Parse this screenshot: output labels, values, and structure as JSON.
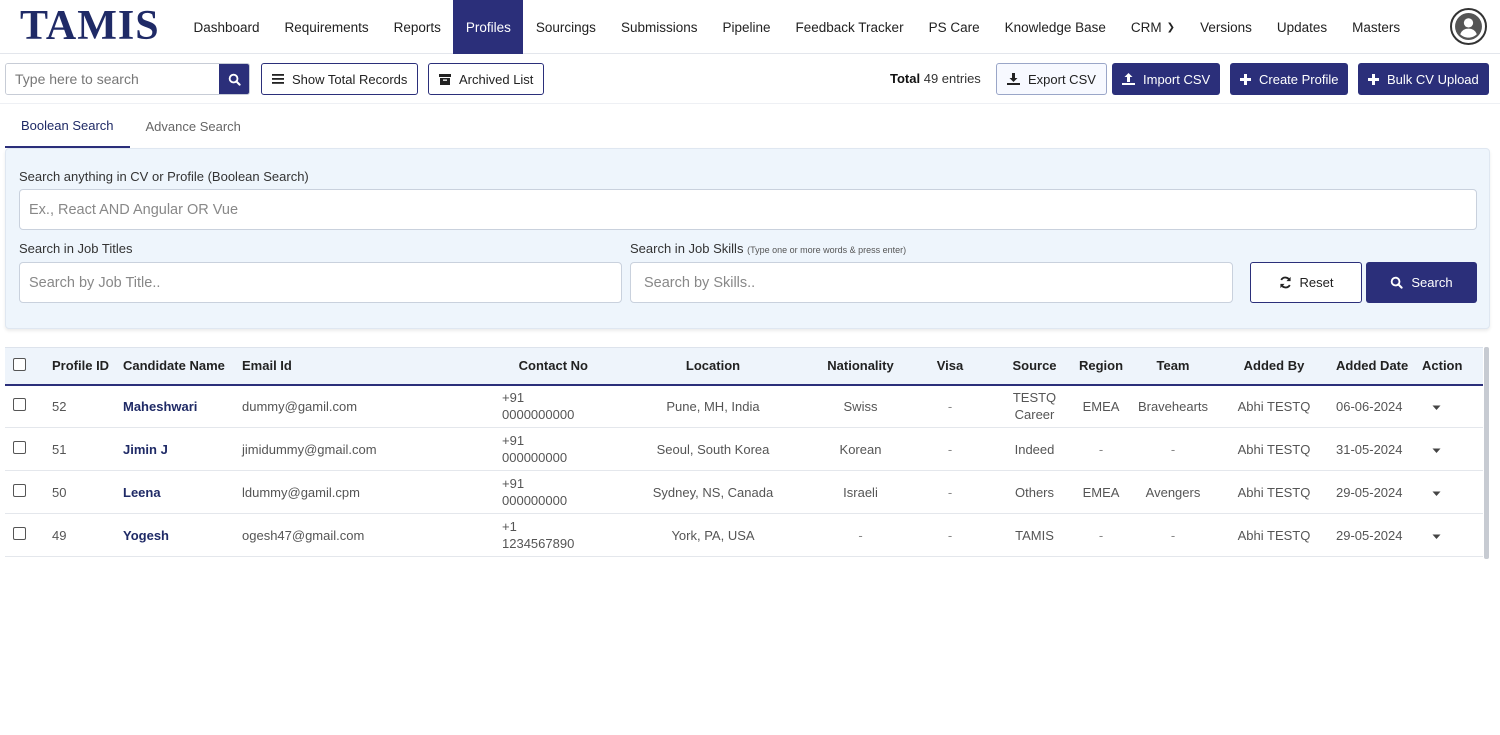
{
  "app": {
    "logo": "TAMIS"
  },
  "nav": {
    "items": [
      {
        "label": "Dashboard"
      },
      {
        "label": "Requirements"
      },
      {
        "label": "Reports"
      },
      {
        "label": "Profiles"
      },
      {
        "label": "Sourcings"
      },
      {
        "label": "Submissions"
      },
      {
        "label": "Pipeline"
      },
      {
        "label": "Feedback Tracker"
      },
      {
        "label": "PS Care"
      },
      {
        "label": "Knowledge Base"
      },
      {
        "label": "CRM"
      },
      {
        "label": "Versions"
      },
      {
        "label": "Updates"
      },
      {
        "label": "Masters"
      }
    ],
    "active": "Profiles"
  },
  "toolbar": {
    "search_placeholder": "Type here to search",
    "show_total_label": "Show Total Records",
    "archived_label": "Archived List",
    "total_label": "Total",
    "total_count": "49 entries",
    "export_label": "Export CSV",
    "import_label": "Import CSV",
    "create_label": "Create Profile",
    "bulk_label": "Bulk CV Upload"
  },
  "tabs": [
    {
      "label": "Boolean Search"
    },
    {
      "label": "Advance Search"
    }
  ],
  "search_panel": {
    "boolean_label": "Search anything in CV or Profile (Boolean Search)",
    "boolean_placeholder": "Ex., React AND Angular OR Vue",
    "titles_label": "Search in Job Titles",
    "titles_placeholder": "Search by Job Title..",
    "skills_label": "Search in Job Skills",
    "skills_hint": "(Type one or more words & press enter)",
    "skills_placeholder": "Search by Skills..",
    "reset_label": "Reset",
    "search_label": "Search"
  },
  "table": {
    "headers": {
      "profile_id": "Profile ID",
      "name": "Candidate Name",
      "email": "Email Id",
      "contact": "Contact No",
      "location": "Location",
      "nationality": "Nationality",
      "visa": "Visa",
      "source": "Source",
      "region": "Region",
      "team": "Team",
      "added_by": "Added By",
      "added_date": "Added Date",
      "action": "Action"
    },
    "rows": [
      {
        "id": "52",
        "name": "Maheshwari",
        "email": "dummy@gamil.com",
        "contact1": "+91",
        "contact2": "0000000000",
        "location": "Pune, MH, India",
        "nationality": "Swiss",
        "visa": "-",
        "source1": "TESTQ",
        "source2": "Career",
        "region": "EMEA",
        "team": "Bravehearts",
        "added_by": "Abhi TESTQ",
        "added_date": "06-06-2024"
      },
      {
        "id": "51",
        "name": "Jimin J",
        "email": "jimidummy@gmail.com",
        "contact1": "+91",
        "contact2": "000000000",
        "location": "Seoul, South Korea",
        "nationality": "Korean",
        "visa": "-",
        "source1": "Indeed",
        "source2": "",
        "region": "-",
        "team": "-",
        "added_by": "Abhi TESTQ",
        "added_date": "31-05-2024"
      },
      {
        "id": "50",
        "name": "Leena",
        "email": "ldummy@gamil.cpm",
        "contact1": "+91",
        "contact2": "000000000",
        "location": "Sydney, NS, Canada",
        "nationality": "Israeli",
        "visa": "-",
        "source1": "Others",
        "source2": "",
        "region": "EMEA",
        "team": "Avengers",
        "added_by": "Abhi TESTQ",
        "added_date": "29-05-2024"
      },
      {
        "id": "49",
        "name": "Yogesh",
        "email": "ogesh47@gmail.com",
        "contact1": "+1",
        "contact2": "1234567890",
        "location": "York, PA, USA",
        "nationality": "-",
        "visa": "-",
        "source1": "TAMIS",
        "source2": "",
        "region": "-",
        "team": "-",
        "added_by": "Abhi TESTQ",
        "added_date": "29-05-2024"
      }
    ]
  },
  "colors": {
    "brand": "#2b2f7a",
    "logo": "#1f2a66",
    "panel_bg": "#eef5fc"
  }
}
